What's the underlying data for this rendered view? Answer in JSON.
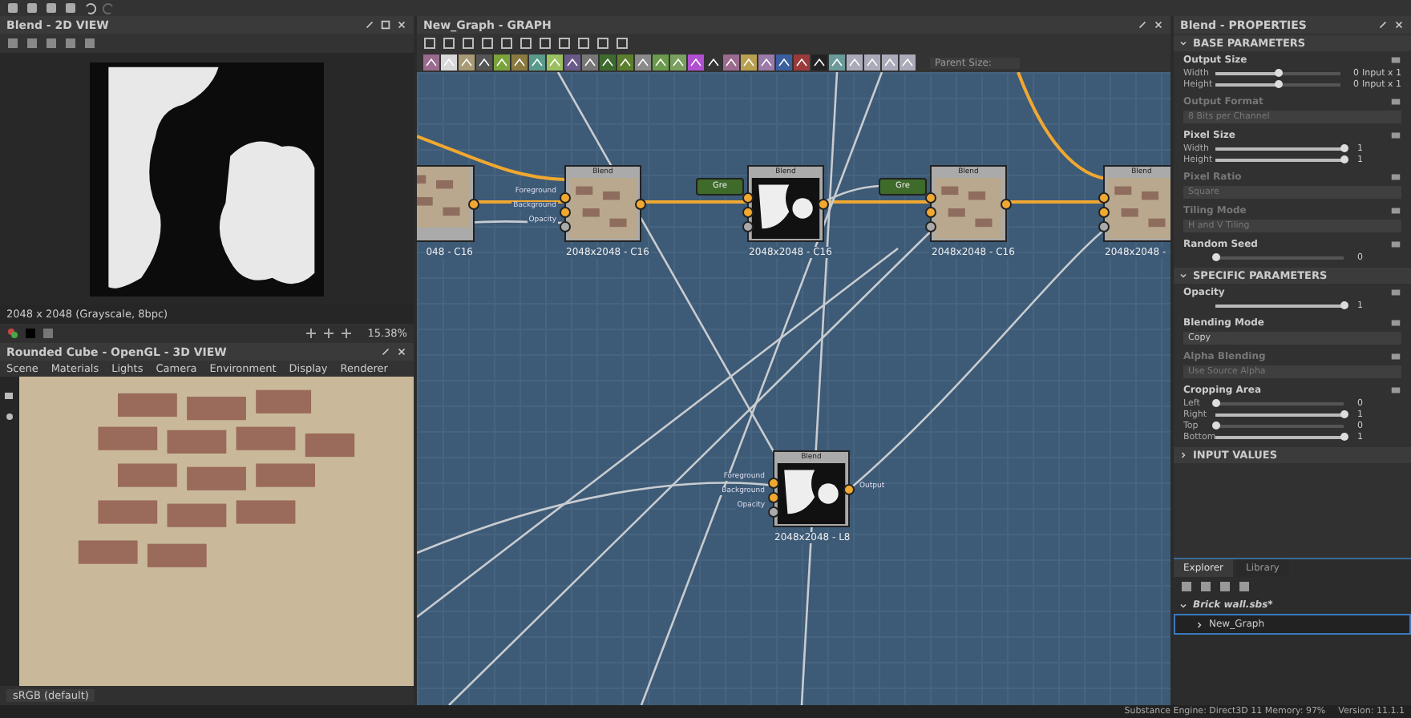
{
  "view2d": {
    "title": "Blend - 2D VIEW",
    "info": "2048 x 2048 (Grayscale, 8bpc)",
    "zoom": "15.38%"
  },
  "view3d": {
    "title": "Rounded Cube - OpenGL - 3D VIEW",
    "menu": [
      "Scene",
      "Materials",
      "Lights",
      "Camera",
      "Environment",
      "Display",
      "Renderer"
    ],
    "colorspace": "sRGB (default)"
  },
  "graph": {
    "title": "New_Graph - GRAPH",
    "parent_size": "Parent Size:",
    "nodes": [
      {
        "kind": "brick_blend",
        "caption": "048 - C16"
      },
      {
        "kind": "brick_blend",
        "title": "Blend",
        "caption": "2048x2048 - C16",
        "ports": [
          "Foreground",
          "Background",
          "Opacity"
        ]
      },
      {
        "kind": "mask_blend",
        "title": "Blend",
        "caption": "2048x2048 - C16"
      },
      {
        "kind": "brick_blend",
        "title": "Blend",
        "caption": "2048x2048 - C16"
      },
      {
        "kind": "brick_blend",
        "title": "Blend",
        "caption": "2048x2048 -"
      },
      {
        "kind": "mask_blend",
        "title": "Blend",
        "caption": "2048x2048 - L8",
        "ports": [
          "Foreground",
          "Background",
          "Opacity"
        ],
        "output": "Output"
      },
      {
        "kind": "grayscale",
        "title": "Gre"
      },
      {
        "kind": "grayscale",
        "title": "Gre"
      }
    ]
  },
  "properties": {
    "title": "Blend - PROPERTIES",
    "sections": [
      {
        "title": "BASE PARAMETERS",
        "expanded": true,
        "params": [
          {
            "kind": "sliders",
            "label": "Output Size",
            "rows": [
              {
                "label": "Width",
                "level": 0.5,
                "value": "0",
                "extra": "Input x 1"
              },
              {
                "label": "Height",
                "level": 0.5,
                "value": "0",
                "extra": "Input x 1"
              }
            ]
          },
          {
            "kind": "dropdown",
            "label": "Output Format",
            "value": "8 Bits per Channel",
            "disabled": true
          },
          {
            "kind": "sliders",
            "label": "Pixel Size",
            "rows": [
              {
                "label": "Width",
                "level": 1,
                "value": "1"
              },
              {
                "label": "Height",
                "level": 1,
                "value": "1"
              }
            ]
          },
          {
            "kind": "dropdown",
            "label": "Pixel Ratio",
            "value": "Square",
            "disabled": true
          },
          {
            "kind": "dropdown",
            "label": "Tiling Mode",
            "value": "H and V Tiling",
            "disabled": true
          },
          {
            "kind": "sliders",
            "label": "Random Seed",
            "rows": [
              {
                "level": 0,
                "value": "0"
              }
            ]
          }
        ]
      },
      {
        "title": "SPECIFIC PARAMETERS",
        "expanded": true,
        "params": [
          {
            "kind": "sliders",
            "label": "Opacity",
            "rows": [
              {
                "level": 1,
                "value": "1"
              }
            ]
          },
          {
            "kind": "dropdown",
            "label": "Blending Mode",
            "value": "Copy",
            "disabled": false
          },
          {
            "kind": "dropdown",
            "label": "Alpha Blending",
            "value": "Use Source Alpha",
            "disabled": true
          },
          {
            "kind": "sliders",
            "label": "Cropping Area",
            "rows": [
              {
                "label": "Left",
                "level": 0,
                "value": "0"
              },
              {
                "label": "Right",
                "level": 1,
                "value": "1"
              },
              {
                "label": "Top",
                "level": 0,
                "value": "0"
              },
              {
                "label": "Bottom",
                "level": 1,
                "value": "1"
              }
            ]
          }
        ]
      },
      {
        "title": "INPUT VALUES",
        "expanded": false
      }
    ]
  },
  "explorer": {
    "tabs": [
      {
        "label": "Explorer",
        "selected": true
      },
      {
        "label": "Library",
        "selected": false
      }
    ],
    "tree": [
      {
        "label": "Brick wall.sbs*",
        "expanded": true,
        "selected": false,
        "children": [
          {
            "label": "New_Graph",
            "expanded": false,
            "selected": true
          }
        ]
      }
    ]
  },
  "status_bar": {
    "engine": "Substance Engine: Direct3D 11   Memory: 97%",
    "version": "Version: 11.1.1"
  }
}
